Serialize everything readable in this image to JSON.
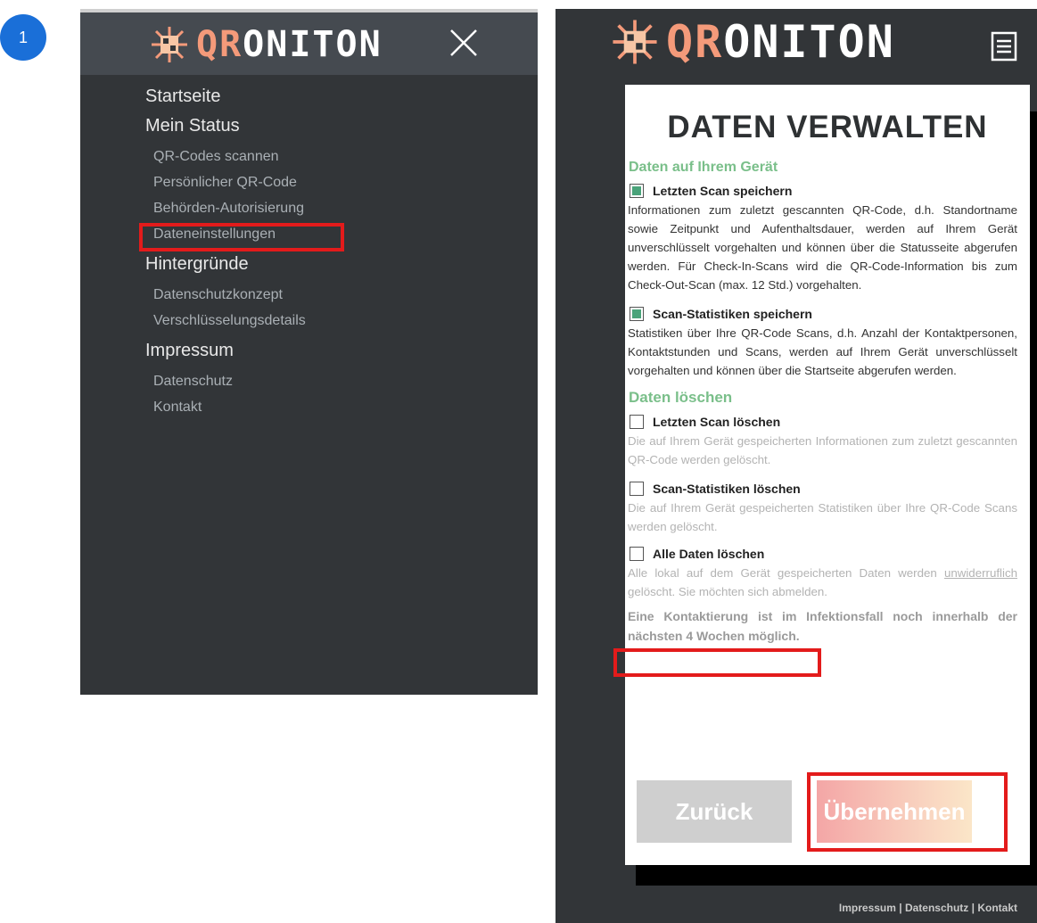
{
  "step_badge": "1",
  "brand": {
    "qr": "QR",
    "rest": "ONITON"
  },
  "menu": {
    "items": [
      {
        "label": "Startseite",
        "level": 1
      },
      {
        "label": "Mein Status",
        "level": 1
      },
      {
        "label": "QR-Codes scannen",
        "level": 2
      },
      {
        "label": "Persönlicher QR-Code",
        "level": 2
      },
      {
        "label": "Behörden-Autorisierung",
        "level": 2
      },
      {
        "label": "Dateneinstellungen",
        "level": 2,
        "highlighted": true
      },
      {
        "label": "Hintergründe",
        "level": 1
      },
      {
        "label": "Datenschutzkonzept",
        "level": 2
      },
      {
        "label": "Verschlüsselungsdetails",
        "level": 2
      },
      {
        "label": "Impressum",
        "level": 1
      },
      {
        "label": "Datenschutz",
        "level": 2
      },
      {
        "label": "Kontakt",
        "level": 2
      }
    ]
  },
  "page": {
    "title": "DATEN VERWALTEN",
    "section_device": "Daten auf Ihrem Gerät",
    "opt_save_last": {
      "label": "Letzten Scan speichern",
      "checked": true,
      "desc": "Informationen zum zuletzt gescannten QR-Code, d.h. Standortname sowie Zeitpunkt und Aufenthaltsdauer, werden auf Ihrem Gerät unverschlüsselt vorgehalten und können über die Statusseite abgerufen werden. Für Check-In-Scans wird die QR-Code-Information bis zum Check-Out-Scan (max. 12 Std.) vorgehalten."
    },
    "opt_save_stats": {
      "label": "Scan-Statistiken speichern",
      "checked": true,
      "desc": "Statistiken über Ihre QR-Code Scans, d.h. Anzahl der Kontaktpersonen, Kontaktstunden und Scans, werden auf Ihrem Gerät unverschlüsselt vorgehalten und können über die Startseite abgerufen werden."
    },
    "section_delete": "Daten löschen",
    "opt_del_last": {
      "label": "Letzten Scan löschen",
      "checked": false,
      "desc": "Die auf Ihrem Gerät gespeicherten Informationen zum zuletzt gescannten QR-Code werden gelöscht."
    },
    "opt_del_stats": {
      "label": "Scan-Statistiken löschen",
      "checked": false,
      "desc": "Die auf Ihrem Gerät gespeicherten Statistiken über Ihre QR-Code Scans werden gelöscht."
    },
    "opt_del_all": {
      "label": "Alle Daten löschen",
      "checked": false,
      "desc_pre": "Alle lokal auf dem Gerät gespeicherten Daten werden ",
      "desc_ul": "unwiderruflich",
      "desc_post": " gelöscht. Sie möchten sich abmelden."
    },
    "warning": "Eine Kontaktierung ist im Infektionsfall noch innerhalb der nächsten 4 Wochen möglich.",
    "btn_back": "Zurück",
    "btn_apply": "Übernehmen",
    "footer": "Impressum | Datenschutz | Kontakt"
  },
  "colors": {
    "accent_red": "#e31b1b",
    "section_green": "#7abf8a",
    "checkbox_green": "#4aa37a",
    "badge_blue": "#1a6fd8"
  }
}
